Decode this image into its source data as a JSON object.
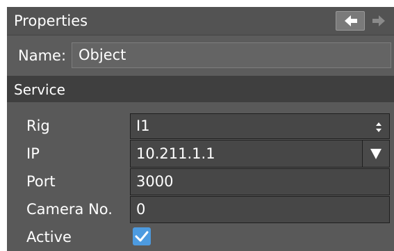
{
  "panel": {
    "title": "Properties",
    "nav": {
      "back_icon": "arrow-left-icon",
      "forward_icon": "arrow-right-icon"
    }
  },
  "name_field": {
    "label": "Name:",
    "value": "Object"
  },
  "service": {
    "title": "Service",
    "rig": {
      "label": "Rig",
      "value": "I1",
      "icon": "updown-stepper-icon"
    },
    "ip": {
      "label": "IP",
      "value": "10.211.1.1",
      "icon": "triangle-down-icon"
    },
    "port": {
      "label": "Port",
      "value": "3000"
    },
    "camera": {
      "label": "Camera No.",
      "value": "0"
    },
    "active": {
      "label": "Active",
      "checked": true,
      "accent": "#4d9be0"
    }
  }
}
